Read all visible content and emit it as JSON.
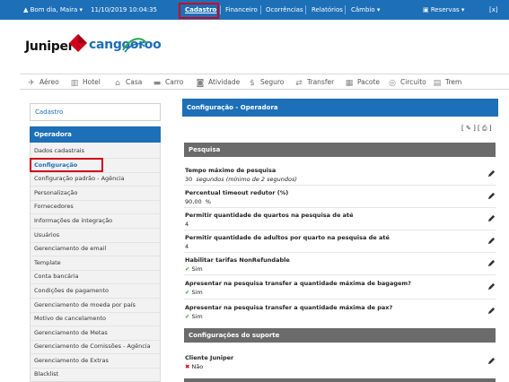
{
  "topbar": {
    "greeting": "Bom dia, Maira",
    "datetime": "11/10/2019 10:04:35",
    "menu": [
      "Cadastro",
      "Financeiro",
      "Ocorrências",
      "Relatórios",
      "Câmbio"
    ],
    "reservas": "Reservas",
    "close": "[x]"
  },
  "logo": {
    "juniper": "Juniper",
    "cangooroo": "cangooroo"
  },
  "services": [
    "Aéreo",
    "Hotel",
    "Casa",
    "Carro",
    "Atividade",
    "Seguro",
    "Transfer",
    "Pacote",
    "Circuito",
    "Trem"
  ],
  "sidebar": {
    "cadastro": "Cadastro",
    "header": "Operadora",
    "items": [
      "Dados cadastrais",
      "Configuração",
      "Configuração padrão - Agência",
      "Personalização",
      "Fornecedores",
      "Informações de integração",
      "Usuários",
      "Gerenciamento de email",
      "Template",
      "Conta bancária",
      "Condições de pagamento",
      "Gerenciamento de moeda por país",
      "Motivo de cancelamento",
      "Gerenciamento de Metas",
      "Gerenciamento de Comissões - Agência",
      "Gerenciamento de Extras",
      "Blacklist"
    ]
  },
  "main": {
    "title": "Configuração - Operadora",
    "toolbar": "[ ✎ ] [ 🖶 ]",
    "sections": [
      {
        "title": "Pesquisa",
        "fields": [
          {
            "label": "Tempo máximo de pesquisa",
            "value": "30",
            "hint": "segundos (mínimo de 2 segundos)"
          },
          {
            "label": "Percentual timeout redutor (%)",
            "value": "90,00",
            "hint": "%"
          },
          {
            "label": "Permitir quantidade de quartos na pesquisa de até",
            "value": "4",
            "hint": ""
          },
          {
            "label": "Permitir quantidade de adultos por quarto na pesquisa de até",
            "value": "4",
            "hint": ""
          },
          {
            "label": "Habilitar tarifas NonRefundable",
            "value": "Sim",
            "hint": ""
          },
          {
            "label": "Apresentar na pesquisa transfer a quantidade máxima de bagagem?",
            "value": "Sim",
            "hint": ""
          },
          {
            "label": "Apresentar na pesquisa transfer a quantidade máxima de pax?",
            "value": "Sim",
            "hint": ""
          }
        ]
      },
      {
        "title": "Configurações do suporte",
        "fields": [
          {
            "label": "Cliente Juniper",
            "value": "Não",
            "hint": ""
          }
        ]
      }
    ]
  },
  "colors": {
    "brand_blue": "#1d6fb8",
    "section_gray": "#6b6b6b",
    "highlight_red": "#d0021b",
    "yes_green": "#3aa83a"
  }
}
